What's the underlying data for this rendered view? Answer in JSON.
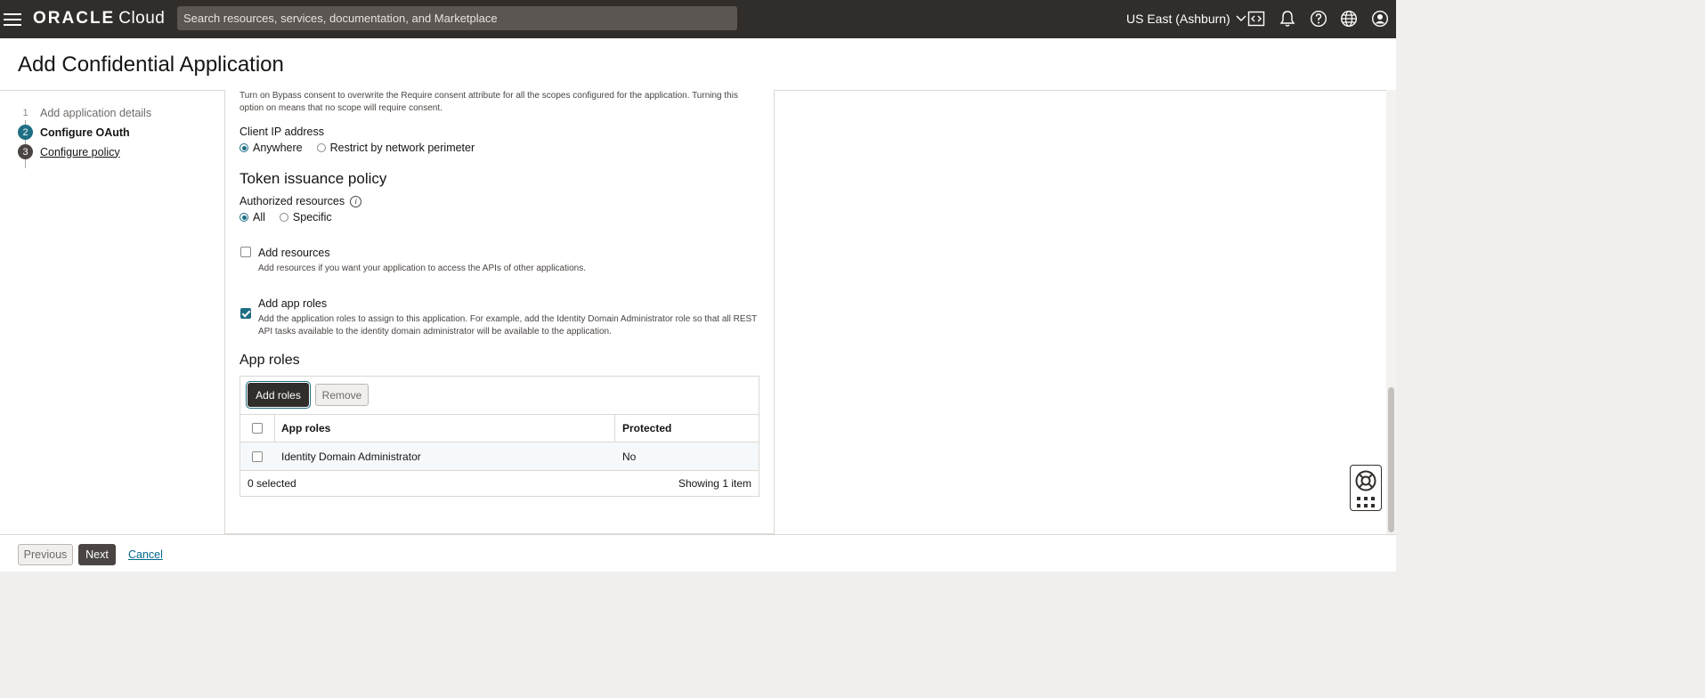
{
  "topbar": {
    "brand": "ORACLE",
    "product": "Cloud",
    "search_placeholder": "Search resources, services, documentation, and Marketplace",
    "region": "US East (Ashburn)",
    "icons": [
      "hamburger-icon",
      "code-icon",
      "bell-icon",
      "help-icon",
      "globe-icon",
      "user-icon"
    ]
  },
  "page": {
    "title": "Add Confidential Application"
  },
  "steps": [
    {
      "number": "1",
      "label": "Add application details"
    },
    {
      "number": "2",
      "label": "Configure OAuth"
    },
    {
      "number": "3",
      "label": "Configure policy"
    }
  ],
  "form": {
    "bypass_desc": "Turn on Bypass consent to overwrite the Require consent attribute for all the scopes configured for the application. Turning this option on means that no scope will require consent.",
    "client_ip": {
      "label": "Client IP address",
      "options": [
        "Anywhere",
        "Restrict by network perimeter"
      ],
      "selected": "Anywhere"
    },
    "token_policy": {
      "title": "Token issuance policy",
      "authorized_label": "Authorized resources",
      "options": [
        "All",
        "Specific"
      ],
      "selected": "All"
    },
    "add_resources": {
      "label": "Add resources",
      "desc": "Add resources if you want your application to access the APIs of other applications.",
      "checked": false
    },
    "add_app_roles": {
      "label": "Add app roles",
      "desc": "Add the application roles to assign to this application. For example, add the Identity Domain Administrator role so that all REST API tasks available to the identity domain administrator will be available to the application.",
      "checked": true
    },
    "app_roles": {
      "title": "App roles",
      "add_button": "Add roles",
      "remove_button": "Remove",
      "columns": [
        "App roles",
        "Protected"
      ],
      "rows": [
        {
          "role": "Identity Domain Administrator",
          "protected": "No"
        }
      ],
      "selected_count": "0 selected",
      "showing": "Showing 1 item"
    }
  },
  "footer": {
    "previous": "Previous",
    "next": "Next",
    "cancel": "Cancel"
  },
  "colors": {
    "topbar": "#312d2a",
    "accent": "#1e6e84",
    "link": "#00688c"
  }
}
